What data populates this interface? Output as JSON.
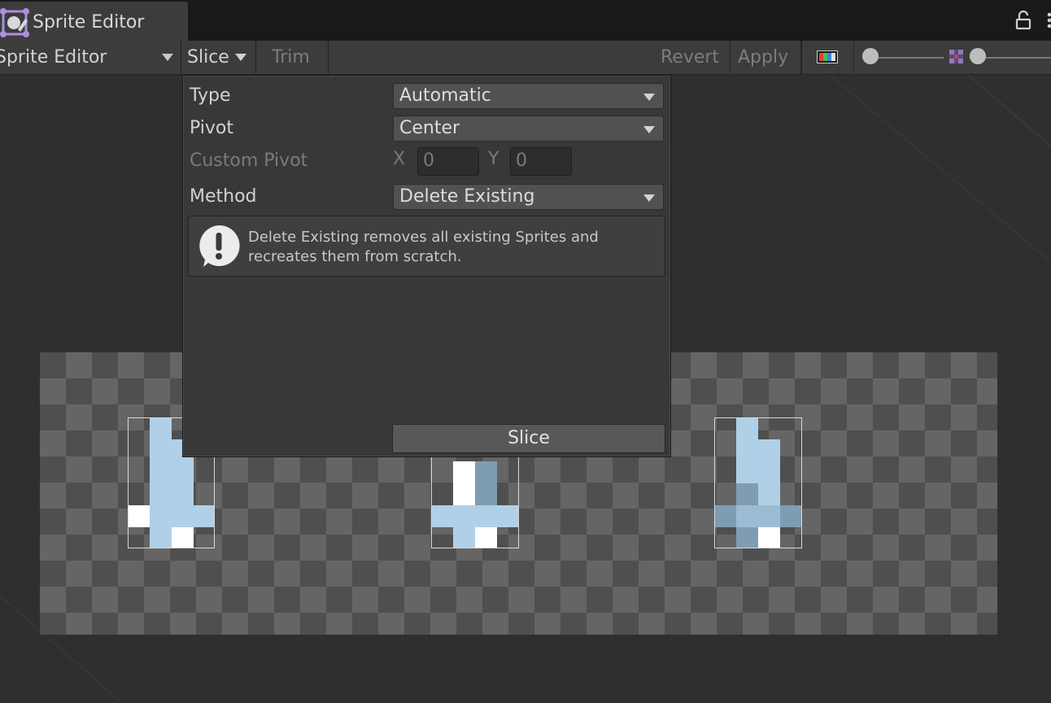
{
  "window": {
    "tab_title": "Sprite Editor"
  },
  "toolbar": {
    "mode_label": "Sprite Editor",
    "slice_label": "Slice",
    "trim_label": "Trim",
    "revert_label": "Revert",
    "apply_label": "Apply"
  },
  "slice_popup": {
    "type_label": "Type",
    "type_value": "Automatic",
    "pivot_label": "Pivot",
    "pivot_value": "Center",
    "custom_pivot_label": "Custom Pivot",
    "x_label": "X",
    "x_value": "0",
    "y_label": "Y",
    "y_value": "0",
    "method_label": "Method",
    "method_value": "Delete Existing",
    "help_text": "Delete Existing removes all existing Sprites and recreates them from scratch.",
    "slice_button": "Slice"
  },
  "colors": {
    "sprite_light": "#b0d0e8",
    "sprite_dark": "#7f9db2",
    "white": "#ffffff",
    "background": "#2f2f2f",
    "panel": "#3c3c3c"
  }
}
